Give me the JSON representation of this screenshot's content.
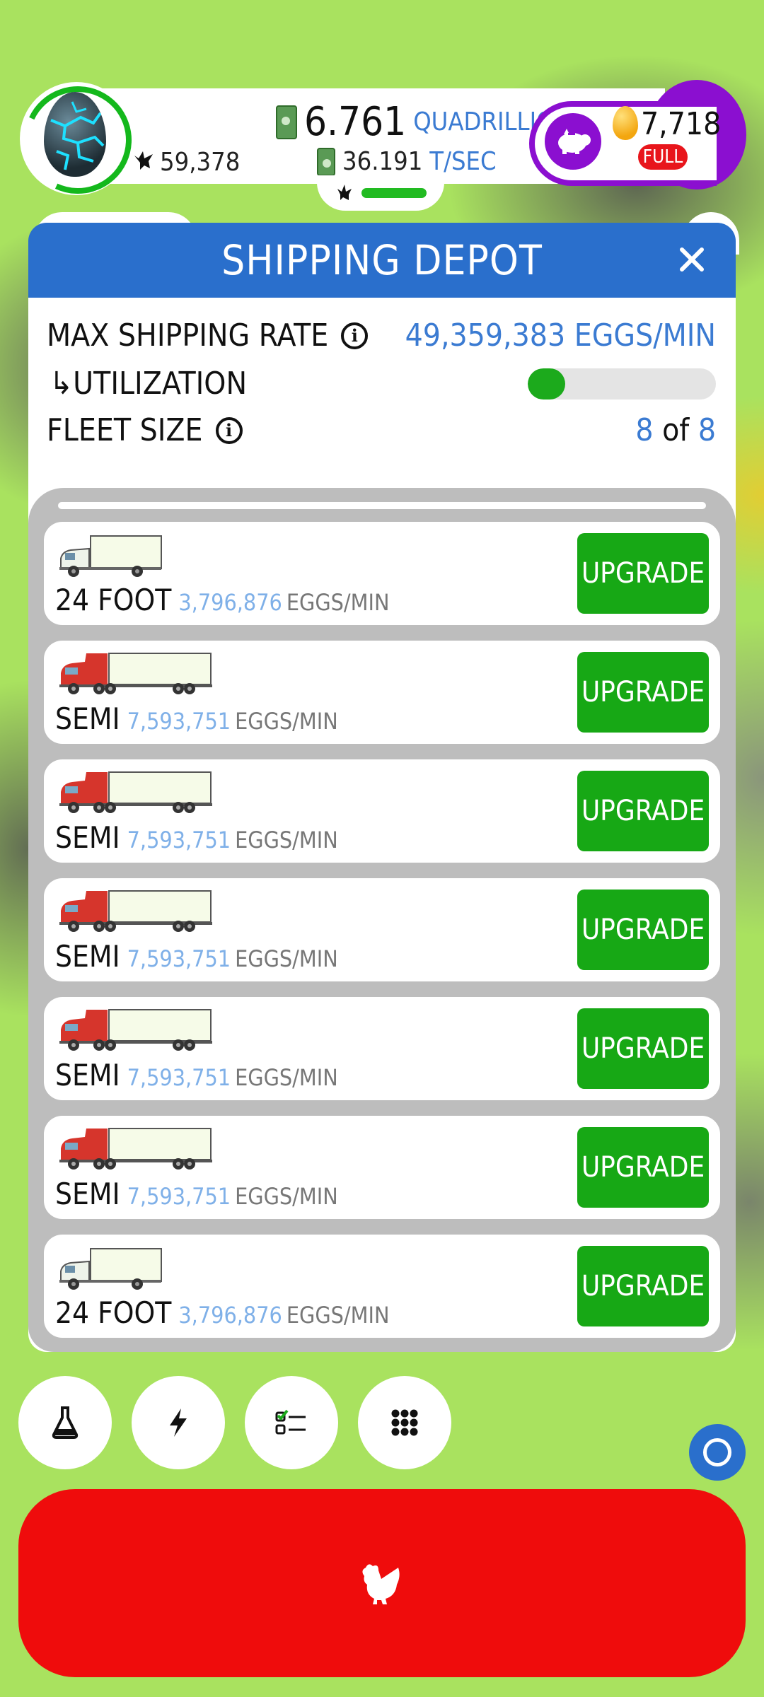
{
  "hud": {
    "chicken_count": "59,378",
    "money_value": "6.761",
    "money_unit": "QUADRILLION",
    "rate_value": "36.191",
    "rate_unit": "T/SEC",
    "golden_eggs": "7,718",
    "piggy_status": "FULL"
  },
  "panel": {
    "title": "SHIPPING DEPOT",
    "max_rate_label": "MAX SHIPPING RATE",
    "max_rate_value": "49,359,383 EGGS/MIN",
    "utilization_label": "↳UTILIZATION",
    "utilization_fraction": 0.2,
    "fleet_label": "FLEET SIZE",
    "fleet_current": "8",
    "fleet_of": "of",
    "fleet_max": "8"
  },
  "vehicles": [
    {
      "type": "24-foot",
      "name": "24 FOOT",
      "rate": "3,796,876",
      "units": "EGGS/MIN",
      "button": "UPGRADE"
    },
    {
      "type": "semi",
      "name": "SEMI",
      "rate": "7,593,751",
      "units": "EGGS/MIN",
      "button": "UPGRADE"
    },
    {
      "type": "semi",
      "name": "SEMI",
      "rate": "7,593,751",
      "units": "EGGS/MIN",
      "button": "UPGRADE"
    },
    {
      "type": "semi",
      "name": "SEMI",
      "rate": "7,593,751",
      "units": "EGGS/MIN",
      "button": "UPGRADE"
    },
    {
      "type": "semi",
      "name": "SEMI",
      "rate": "7,593,751",
      "units": "EGGS/MIN",
      "button": "UPGRADE"
    },
    {
      "type": "semi",
      "name": "SEMI",
      "rate": "7,593,751",
      "units": "EGGS/MIN",
      "button": "UPGRADE"
    },
    {
      "type": "24-foot",
      "name": "24 FOOT",
      "rate": "3,796,876",
      "units": "EGGS/MIN",
      "button": "UPGRADE"
    }
  ],
  "bottom_buttons": [
    {
      "icon": "flask-icon"
    },
    {
      "icon": "lightning-icon"
    },
    {
      "icon": "checklist-icon"
    },
    {
      "icon": "grid-menu-icon"
    }
  ],
  "colors": {
    "header_blue": "#2a6fcc",
    "upgrade_green": "#17a815",
    "hatch_red": "#ef0c0c",
    "premium_purple": "#8b0fd0"
  }
}
